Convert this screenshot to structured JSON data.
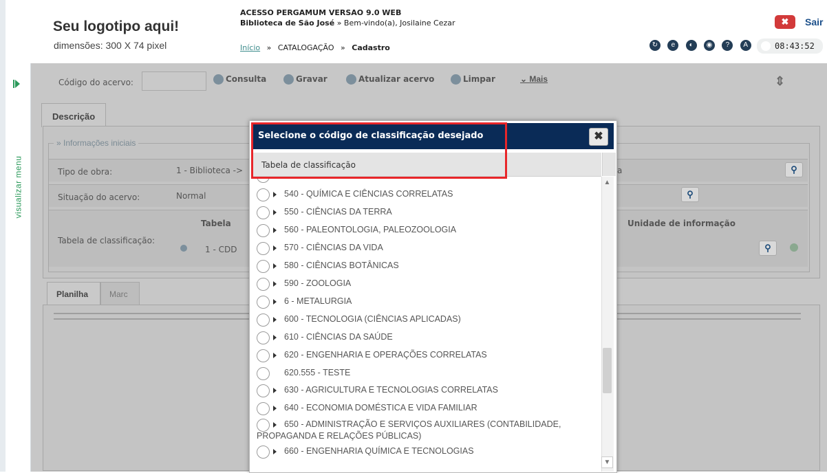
{
  "header": {
    "logo_title": "Seu logotipo aqui!",
    "logo_subtitle": "dimensões: 300 X 74 pixel",
    "access_title": "ACESSO PERGAMUM VERSAO 9.0 WEB",
    "library": "Biblioteca de São José",
    "welcome": "» Bem-vindo(a), Josilaine Cezar",
    "breadcrumb": [
      "Início",
      "CATALOGAÇÃO",
      "Cadastro"
    ],
    "breadcrumb_sep": "»",
    "exit_label": "Sair",
    "exit_icon": "x-icon",
    "clock": "08:43:52",
    "icons": [
      "refresh-icon",
      "ie-icon",
      "help-icon",
      "world-icon",
      "question-icon",
      "a-icon"
    ]
  },
  "sidebar": {
    "toggle_icon": "expand-arrow-icon",
    "label": "visualizar menu"
  },
  "toolbar": {
    "code_label": "Código do acervo:",
    "code_value": "",
    "buttons": [
      "Consulta",
      "Gravar",
      "Atualizar acervo",
      "Limpar"
    ],
    "more_label": "Mais"
  },
  "form": {
    "tab_description": "Descrição",
    "section_legend": "» Informações iniciais",
    "fields": {
      "work_type_label": "Tipo de obra:",
      "work_type_value": "1 - Biblioteca ->",
      "work_type_right": "a",
      "status_label": "Situação do acervo:",
      "status_value": "Normal",
      "class_table_label": "Tabela de classificação:",
      "class_col_table": "Tabela",
      "class_col_unit": "Unidade de informação",
      "class_value": "1 - CDD"
    },
    "lower_tabs": [
      "Planilha",
      "Marc"
    ]
  },
  "modal": {
    "title": "Selecione o código de classificação desejado",
    "column_header": "Tabela de classificação",
    "items": [
      {
        "label": "540 - QUÍMICA E CIÊNCIAS CORRELATAS",
        "expandable": true
      },
      {
        "label": "550 - CIÊNCIAS DA TERRA",
        "expandable": true
      },
      {
        "label": "560 - PALEONTOLOGIA, PALEOZOOLOGIA",
        "expandable": true
      },
      {
        "label": "570 - CIÊNCIAS DA VIDA",
        "expandable": true
      },
      {
        "label": "580 - CIÊNCIAS BOTÂNICAS",
        "expandable": true
      },
      {
        "label": "590 - ZOOLOGIA",
        "expandable": true
      },
      {
        "label": "6 - METALURGIA",
        "expandable": true
      },
      {
        "label": "600 - TECNOLOGIA (CIÊNCIAS APLICADAS)",
        "expandable": true
      },
      {
        "label": "610 - CIÊNCIAS DA SAÚDE",
        "expandable": true
      },
      {
        "label": "620 - ENGENHARIA E OPERAÇÕES CORRELATAS",
        "expandable": true
      },
      {
        "label": "620.555 - TESTE",
        "expandable": false
      },
      {
        "label": "630 - AGRICULTURA E TECNOLOGIAS CORRELATAS",
        "expandable": true
      },
      {
        "label": "640 - ECONOMIA DOMÉSTICA E VIDA FAMILIAR",
        "expandable": true
      },
      {
        "label": "650 - ADMINISTRAÇÃO E SERVIÇOS AUXILIARES (CONTABILIDADE, PROPAGANDA E RELAÇÕES PÚBLICAS)",
        "expandable": true
      },
      {
        "label": "660 - ENGENHARIA QUÍMICA E TECNOLOGIAS",
        "expandable": true
      }
    ]
  }
}
